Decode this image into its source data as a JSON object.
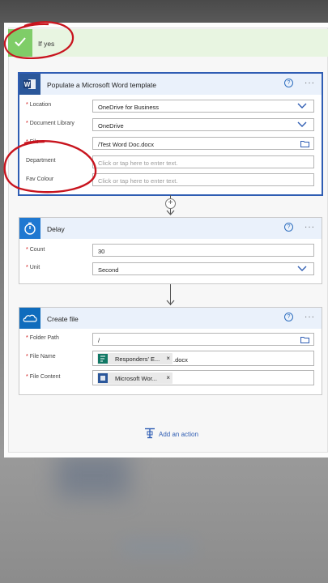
{
  "if_yes": {
    "label": "If yes"
  },
  "word_card": {
    "title": "Populate a Microsoft Word template",
    "help": "?",
    "more": "···",
    "fields": [
      {
        "label": "Location",
        "required": true,
        "value": "OneDrive for Business",
        "kind": "dropdown"
      },
      {
        "label": "Document Library",
        "required": true,
        "value": "OneDrive",
        "kind": "dropdown"
      },
      {
        "label": "File",
        "required": true,
        "value": "/Test Word Doc.docx",
        "kind": "file"
      },
      {
        "label": "Department",
        "required": false,
        "placeholder": "Click or tap here to enter text.",
        "kind": "text"
      },
      {
        "label": "Fav Colour",
        "required": false,
        "placeholder": "Click or tap here to enter text.",
        "kind": "text"
      }
    ]
  },
  "connector_plus": "+",
  "delay_card": {
    "title": "Delay",
    "help": "?",
    "more": "···",
    "fields": [
      {
        "label": "Count",
        "required": true,
        "value": "30"
      },
      {
        "label": "Unit",
        "required": true,
        "value": "Second"
      }
    ]
  },
  "create_card": {
    "title": "Create file",
    "help": "?",
    "more": "···",
    "fields": [
      {
        "label": "Folder Path",
        "required": true,
        "value": "/"
      },
      {
        "label": "File Name",
        "required": true,
        "token": "Responders' E...",
        "suffix": ".docx"
      },
      {
        "label": "File Content",
        "required": true,
        "token": "Microsoft Wor..."
      }
    ]
  },
  "token_close": "×",
  "required_mark": "*",
  "add_action": {
    "label": "Add an action"
  },
  "colors": {
    "accent": "#2f5db3",
    "success": "#7fcd68",
    "annotation": "#c8141e",
    "word_blue": "#2b579a",
    "forms_green": "#117865"
  },
  "icons": [
    "checkmark-icon",
    "word-icon",
    "timer-icon",
    "onedrive-cloud-icon",
    "chevron-down-icon",
    "folder-icon",
    "add-action-icon"
  ]
}
